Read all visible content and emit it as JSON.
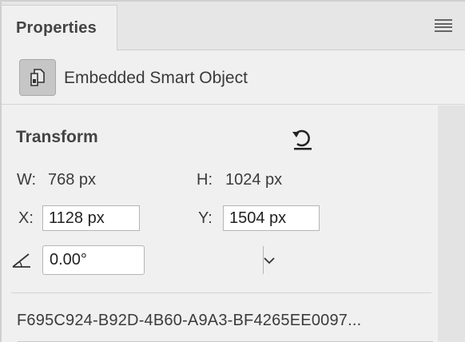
{
  "panel": {
    "tab_label": "Properties",
    "menu_icon": "hamburger-menu-icon"
  },
  "layer": {
    "kind_icon": "smart-object-icon",
    "kind_label": "Embedded Smart Object"
  },
  "transform": {
    "title": "Transform",
    "reset_icon": "reset-transform-icon",
    "w_label": "W:",
    "w_value": "768 px",
    "h_label": "H:",
    "h_value": "1024 px",
    "x_label": "X:",
    "x_value": "1128 px",
    "y_label": "Y:",
    "y_value": "1504 px",
    "angle_icon": "angle-icon",
    "angle_value": "0.00°",
    "angle_dropdown_icon": "chevron-down-icon"
  },
  "smart_object": {
    "id_text": "F695C924-B92D-4B60-A9A3-BF4265EE0097..."
  }
}
